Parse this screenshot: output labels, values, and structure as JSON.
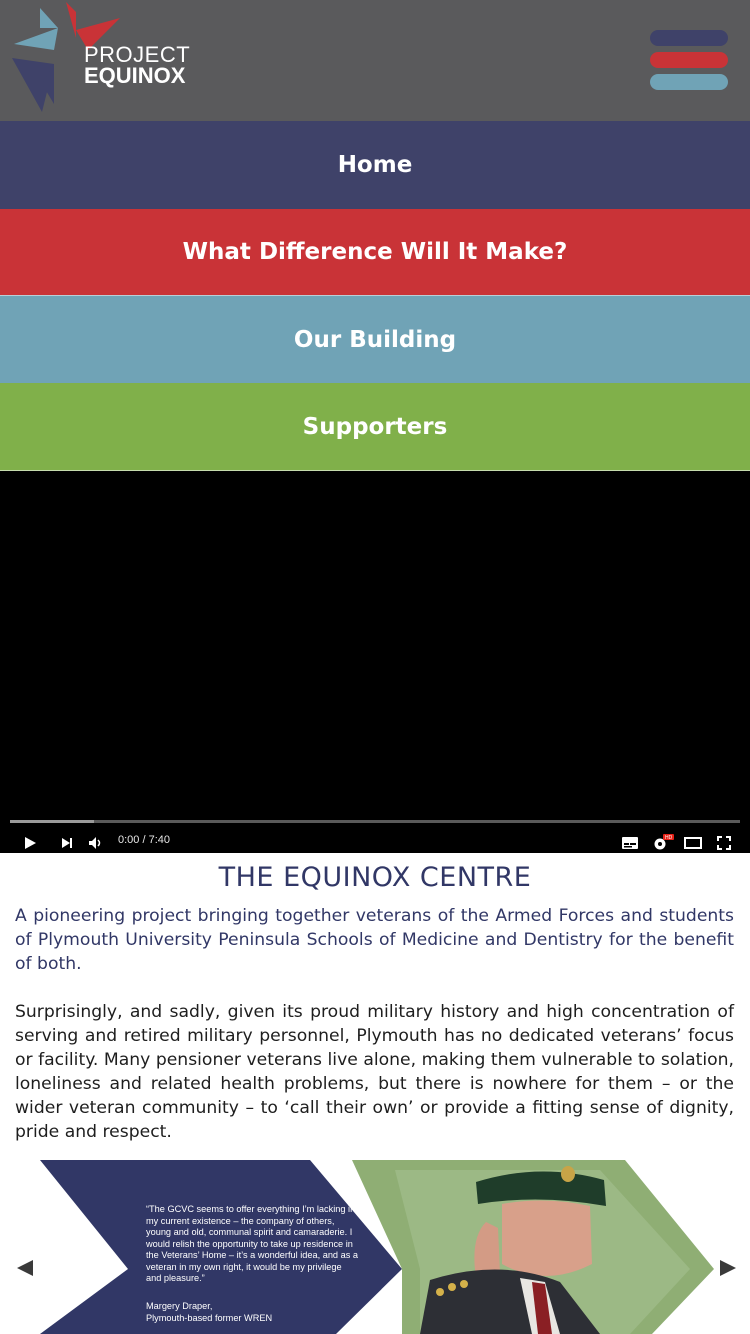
{
  "brand": {
    "line1": "PROJECT",
    "line2": "EQUINOX",
    "colors": {
      "navy": "#3f4269",
      "red": "#c93337",
      "blue": "#70a3b6",
      "green": "#80b04a"
    }
  },
  "menu_icon": "hamburger-icon",
  "nav": {
    "items": [
      {
        "label": "Home",
        "color": "#3f4269"
      },
      {
        "label": "What Difference Will It Make?",
        "color": "#c93337"
      },
      {
        "label": "Our Building",
        "color": "#70a3b6"
      },
      {
        "label": "Supporters",
        "color": "#80b04a"
      }
    ]
  },
  "video": {
    "time": "0:00 / 7:40",
    "progress": 0.115,
    "icons": [
      "play-icon",
      "next-icon",
      "volume-icon",
      "subtitles-icon",
      "settings-hd-icon",
      "theater-mode-icon",
      "fullscreen-icon"
    ]
  },
  "content": {
    "title": "THE EQUINOX CENTRE",
    "intro": "A pioneering project bringing together veterans of the Armed Forces and students of Plymouth University Peninsula Schools of Medicine and Dentistry for the benefit of both.",
    "body": "Surprisingly, and sadly, given its proud military history and high concentration of serving and retired military personnel, Plymouth has no dedicated veterans’ focus or facility. Many pensioner veterans live alone, making them vulnerable to solation, loneliness and related health problems, but there is nowhere for them – or the wider veteran community – to ‘call their own’ or provide a fitting sense of dignity, pride and respect."
  },
  "slider": {
    "quote": "“The GCVC seems to offer everything I’m lacking in my current existence – the company of others, young and old, communal spirit and camaraderie. I would relish the opportunity to take up residence in the Veterans’ Home – it’s a wonderful idea, and as a veteran in my own right, it would be my privilege and pleasure.”",
    "author_name": "Margery Draper,",
    "author_role": "Plymouth-based former WREN",
    "prev_icon": "arrow-left-icon",
    "next_icon": "arrow-right-icon"
  }
}
